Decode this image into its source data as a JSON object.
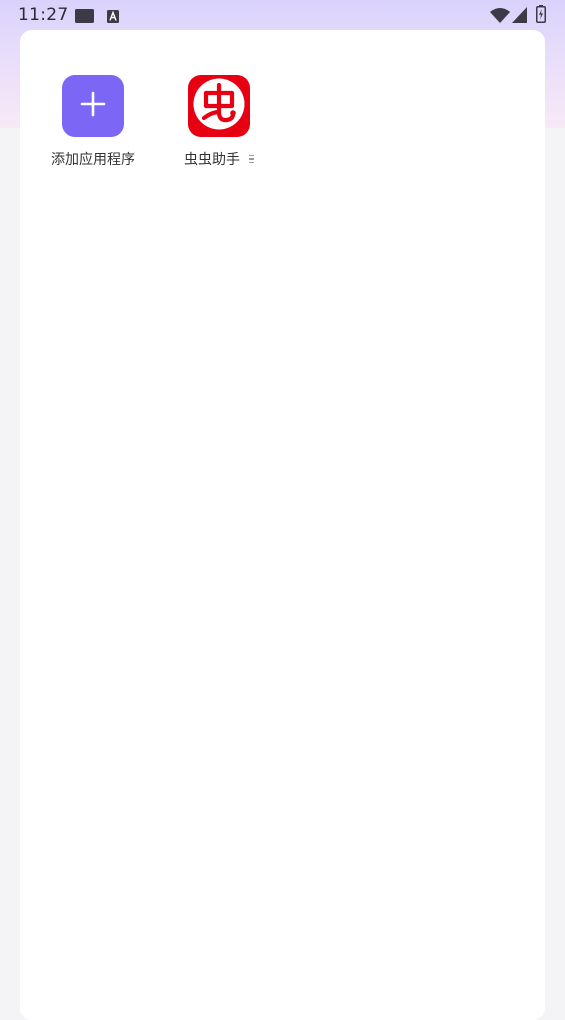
{
  "status_bar": {
    "time": "11:27",
    "icons": [
      "card-icon",
      "keyboard-a-icon",
      "wifi-icon",
      "cell-signal-icon",
      "battery-charging-icon"
    ]
  },
  "apps": [
    {
      "label": "添加应用程序",
      "icon": "plus-icon",
      "color": "#7b66f5"
    },
    {
      "label": "虫虫助手",
      "icon": "chongchong-logo",
      "color": "#e60012"
    }
  ],
  "colors": {
    "header_gradient_top": "#d9d2fb",
    "header_gradient_bottom": "#f8e9f6",
    "card_background": "#ffffff",
    "page_background": "#f4f4f6"
  }
}
